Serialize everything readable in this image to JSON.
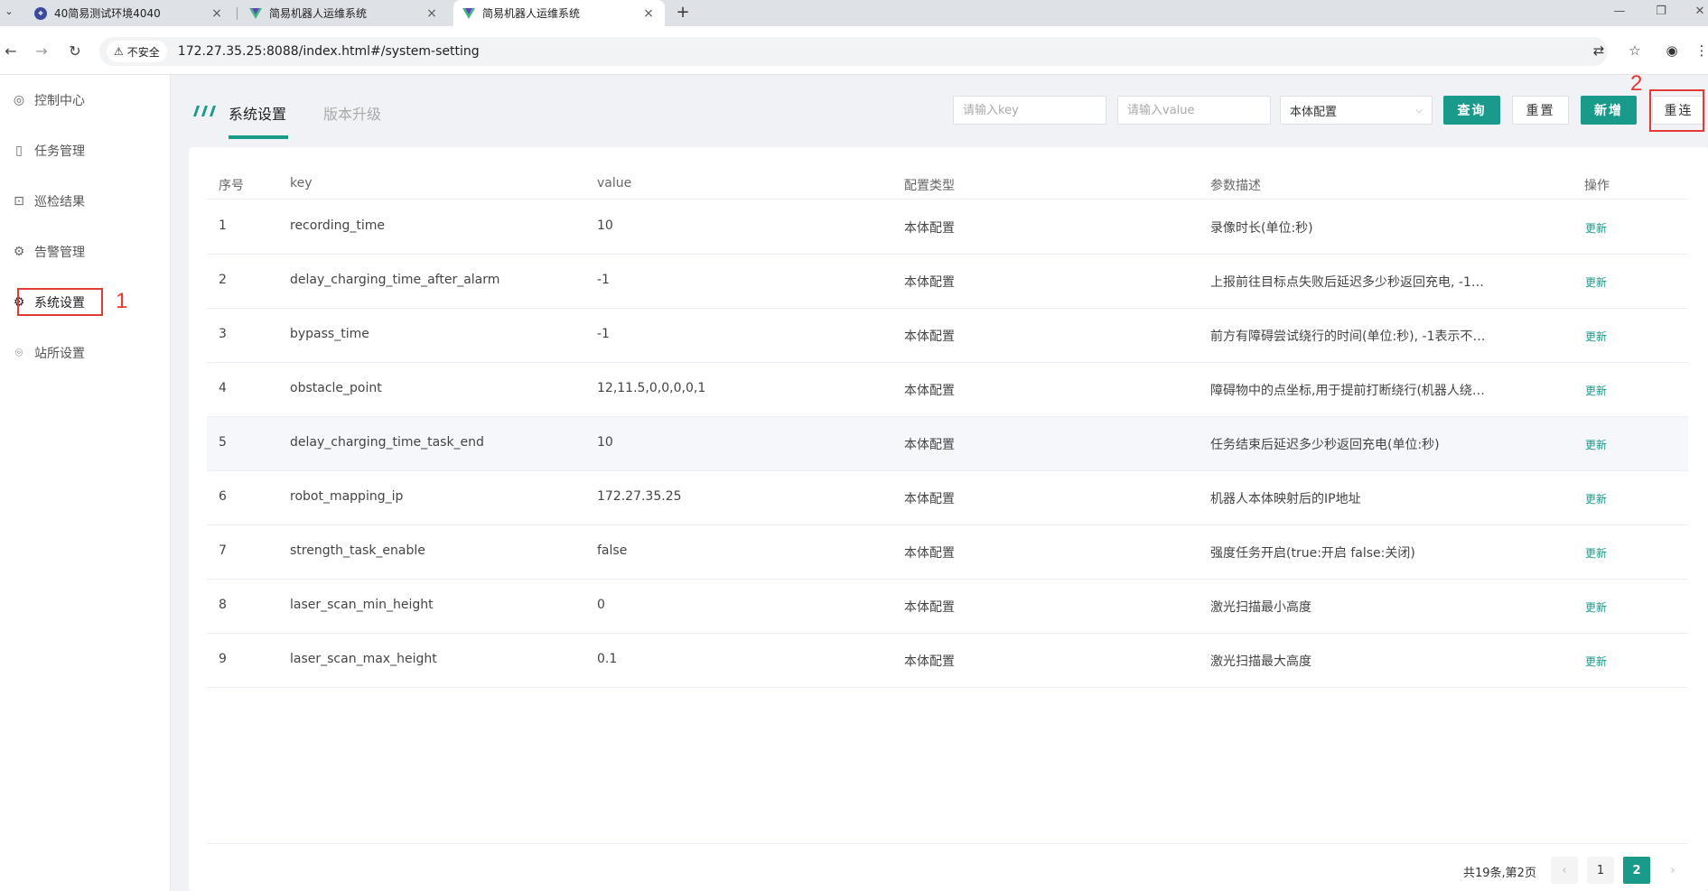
{
  "browser": {
    "tabs": [
      {
        "title": "40简易测试环境4040"
      },
      {
        "title": "简易机器人运维系统"
      },
      {
        "title": "简易机器人运维系统"
      }
    ],
    "security_label": "不安全",
    "url": "172.27.35.25:8088/index.html#/system-setting"
  },
  "sidebar": {
    "items": [
      {
        "label": "控制中心",
        "icon": "dashboard-icon"
      },
      {
        "label": "任务管理",
        "icon": "task-icon"
      },
      {
        "label": "巡检结果",
        "icon": "result-icon"
      },
      {
        "label": "告警管理",
        "icon": "alarm-icon"
      },
      {
        "label": "系统设置",
        "icon": "gear-icon"
      },
      {
        "label": "站所设置",
        "icon": "location-icon"
      }
    ],
    "active": "系统设置"
  },
  "annotations": {
    "one": "1",
    "two": "2"
  },
  "page_tabs": {
    "active": "系统设置",
    "inactive": "版本升级"
  },
  "filters": {
    "key_placeholder": "请输入key",
    "value_placeholder": "请输入value",
    "config_type": "本体配置",
    "query_label": "查询",
    "reset_label": "重置",
    "add_label": "新增",
    "reconnect_label": "重连"
  },
  "table": {
    "headers": [
      "序号",
      "key",
      "value",
      "配置类型",
      "参数描述",
      "操作"
    ],
    "rows": [
      {
        "no": "1",
        "key": "recording_time",
        "value": "10",
        "type": "本体配置",
        "desc": "录像时长(单位:秒)",
        "op": "更新"
      },
      {
        "no": "2",
        "key": "delay_charging_time_after_alarm",
        "value": "-1",
        "type": "本体配置",
        "desc": "上报前往目标点失败后延迟多少秒返回充电, -1表…",
        "op": "更新"
      },
      {
        "no": "3",
        "key": "bypass_time",
        "value": "-1",
        "type": "本体配置",
        "desc": "前方有障碍尝试绕行的时间(单位:秒), -1表示不提…",
        "op": "更新"
      },
      {
        "no": "4",
        "key": "obstacle_point",
        "value": "12,11.5,0,0,0,0,1",
        "type": "本体配置",
        "desc": "障碍物中的点坐标,用于提前打断绕行(机器人绕…",
        "op": "更新"
      },
      {
        "no": "5",
        "key": "delay_charging_time_task_end",
        "value": "10",
        "type": "本体配置",
        "desc": "任务结束后延迟多少秒返回充电(单位:秒)",
        "op": "更新"
      },
      {
        "no": "6",
        "key": "robot_mapping_ip",
        "value": "172.27.35.25",
        "type": "本体配置",
        "desc": "机器人本体映射后的IP地址",
        "op": "更新"
      },
      {
        "no": "7",
        "key": "strength_task_enable",
        "value": "false",
        "type": "本体配置",
        "desc": "强度任务开启(true:开启 false:关闭)",
        "op": "更新"
      },
      {
        "no": "8",
        "key": "laser_scan_min_height",
        "value": "0",
        "type": "本体配置",
        "desc": "激光扫描最小高度",
        "op": "更新"
      },
      {
        "no": "9",
        "key": "laser_scan_max_height",
        "value": "0.1",
        "type": "本体配置",
        "desc": "激光扫描最大高度",
        "op": "更新"
      }
    ]
  },
  "pagination": {
    "total_text": "共19条,第2页",
    "pages": [
      "1",
      "2"
    ],
    "current": "2"
  },
  "colors": {
    "accent": "#1a9a8a",
    "annotation": "#e53935"
  }
}
